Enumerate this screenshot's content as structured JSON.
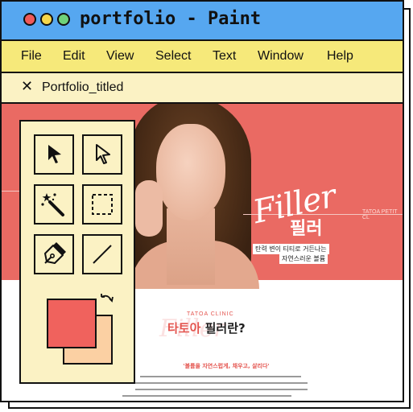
{
  "window": {
    "title": "portfolio - Paint",
    "controls": [
      "close",
      "minimize",
      "maximize"
    ]
  },
  "menu": {
    "items": [
      "File",
      "Edit",
      "View",
      "Select",
      "Text",
      "Window",
      "Help"
    ]
  },
  "tab": {
    "close_icon": "close-icon",
    "title": "Portfolio_titled"
  },
  "toolbox": {
    "tools": [
      {
        "name": "select-arrow",
        "icon": "arrow-filled-icon"
      },
      {
        "name": "direct-select",
        "icon": "arrow-outline-icon"
      },
      {
        "name": "magic-wand",
        "icon": "magic-wand-icon"
      },
      {
        "name": "marquee-select",
        "icon": "dashed-rectangle-icon"
      },
      {
        "name": "pen",
        "icon": "pen-nib-icon"
      },
      {
        "name": "line",
        "icon": "line-icon"
      }
    ],
    "colors": {
      "primary": "#f0625d",
      "secondary": "#fbd0a3"
    },
    "swap_icon": "swap-arrows-icon"
  },
  "canvas": {
    "banner": {
      "script_text": "Filler",
      "korean_title": "필러",
      "tag": "TATOA PETIT CL",
      "sub1": "탄력 변이 티티로 거든나는",
      "sub2": "자연스러운 볼륨"
    },
    "clinic": {
      "tag": "TATOA CLINIC",
      "background_script": "Filler",
      "title_accent": "타토아",
      "title_rest": " 필러란?",
      "slogan": "'볼륨을 자연스럽게, 채우고, 살리다'"
    },
    "theme": {
      "banner_color": "#ea6a63",
      "titlebar_color": "#56a7f0",
      "menubar_color": "#f6e97a",
      "tabbar_color": "#fbf2c4"
    }
  }
}
